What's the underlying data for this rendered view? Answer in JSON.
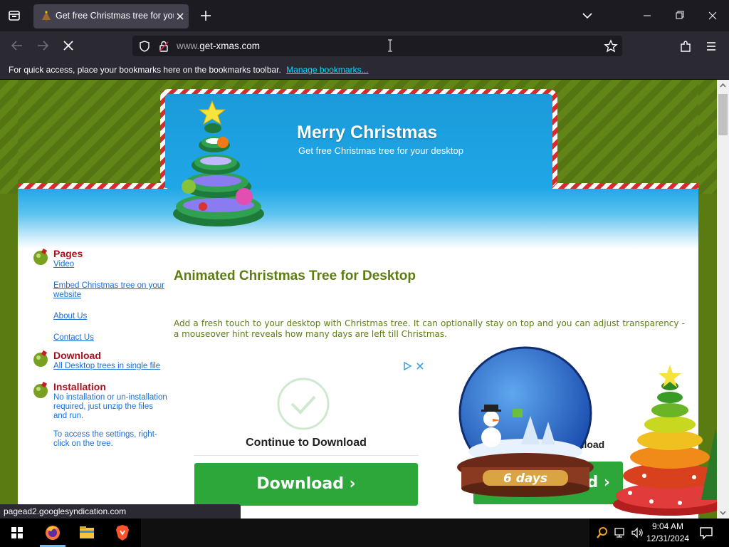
{
  "browser": {
    "tab": {
      "title": "Get free Christmas tree for your desktop"
    },
    "url": {
      "host": "www.",
      "domain": "get-xmas.com"
    },
    "bookmarks_toolbar": {
      "message": "For quick access, place your bookmarks here on the bookmarks toolbar.",
      "manage_link": "Manage bookmarks..."
    },
    "status_url": "pagead2.googlesyndication.com"
  },
  "page": {
    "banner": {
      "title": "Merry Christmas",
      "subtitle": "Get free Christmas tree for your desktop"
    },
    "sidebar": {
      "pages": {
        "heading": "Pages",
        "links": [
          "Video",
          "Embed Christmas tree on your website",
          "About Us",
          "Contact Us"
        ]
      },
      "download": {
        "heading": "Download",
        "link": "All Desktop trees in single file"
      },
      "installation": {
        "heading": "Installation",
        "text1": "No installation or un-installation required, just unzip the files and run.",
        "text2": "To access the settings, right-click on the tree."
      }
    },
    "content": {
      "title": "Animated Christmas Tree for Desktop",
      "paragraph": "Add a fresh touch to your desktop with Christmas tree. It can optionally stay on top and you can adjust transparency - a mouseover hint reveals how many days are left till Christmas."
    },
    "ad": {
      "headline": "Continue to Download",
      "button": "Download ›",
      "partial_text": "wnload",
      "partial_button": "d ›"
    },
    "globe_label": "6 days"
  },
  "taskbar": {
    "time": "9:04 AM",
    "date": "12/31/2024"
  },
  "colors": {
    "accent_green": "#5e7d10",
    "sidebar_heading": "#a8101e",
    "link_blue": "#1a6ed8",
    "download_green": "#2da63a",
    "banner_blue": "#1fa6e6"
  }
}
